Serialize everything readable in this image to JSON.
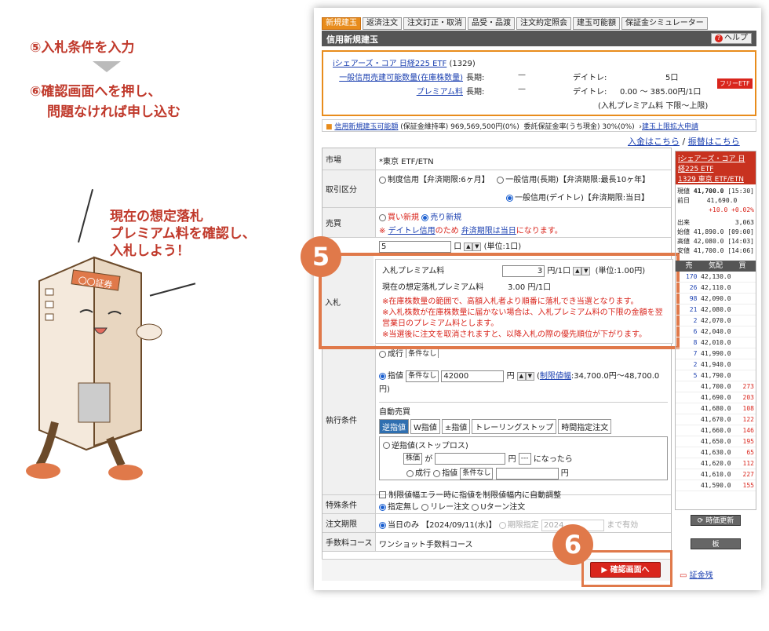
{
  "guide": {
    "step5": "⑤入札条件を入力",
    "step6_line1": "⑥確認画面へを押し、",
    "step6_line2": "問題なければ申し込む",
    "mascot_line1": "現在の想定落札",
    "mascot_line2": "プレミアム料を確認し、",
    "mascot_line3": "入札しよう！",
    "mascot_sign": "〇〇証券",
    "badge5": "5",
    "badge6": "6"
  },
  "tabs": [
    "新規建玉",
    "返済注文",
    "注文訂正・取消",
    "品受・品渡",
    "注文約定照会",
    "建玉可能額",
    "保証金シミュレーター"
  ],
  "header": {
    "title": "信用新規建玉",
    "help": "ヘルプ",
    "help_icon": "?"
  },
  "info": {
    "name": "iシェアーズ・コア 日経225 ETF",
    "code": "(1329)",
    "link_qty": "一般信用売建可能数量(在庫株数量)",
    "period_label1": "長期:",
    "period_val1": "—",
    "daytrade_label1": "デイトレ:",
    "daytrade_val1": "5口",
    "link_premium": "プレミアム料",
    "period_label2": "長期:",
    "period_val2": "—",
    "daytrade_label2": "デイトレ:",
    "daytrade_val2": "0.00 ～ 385.00円/1口",
    "daytrade_note": "(入札プレミアム料 下限～上限)",
    "free_badge": "フリーETF"
  },
  "credit_row": {
    "link1": "信用新規建玉可能額",
    "text1": "(保証金維持率) 969,569,500円(0%)",
    "text2": "委託保証金率(うち現金) 30%(0%)",
    "link2": "建玉上限拡大申請"
  },
  "links": {
    "deposit": "入金はこちら",
    "sep": "/",
    "transfer": "振替はこちら"
  },
  "form": {
    "market_label": "市場",
    "market_value": "*東京 ETF/ETN",
    "kubun_label": "取引区分",
    "kubun_opt1": "制度信用【弁済期限:6ヶ月】",
    "kubun_opt2": "一般信用(長期)【弁済期限:最長10ヶ年】",
    "kubun_opt3": "一般信用(デイトレ)【弁済期限:当日】",
    "baibai_label": "売買",
    "baibai_opt1": "買い新規",
    "baibai_opt2": "売り新規",
    "baibai_note_pre": "※",
    "baibai_note_link1": "デイトレ信用",
    "baibai_note_mid": "のため",
    "baibai_note_link2": "弁済期限は当日",
    "baibai_note_post": "になります。",
    "qty_value": "5",
    "qty_unit": "口",
    "qty_note": "(単位:1口)",
    "nyusatsu_label": "入札",
    "premium_label": "入札プレミアム料",
    "premium_value": "3",
    "premium_unit": "円/1口",
    "premium_note": "(単位:1.00円)",
    "est_label": "現在の想定落札プレミアム料",
    "est_value": "3.00 円/1口",
    "warn1": "※在庫株数量の範囲で、高額入札者より順番に落札でき当選となります。",
    "warn2": "※入札株数が在庫株数量に届かない場合は、入札プレミアム料の下限の金額を翌営業日のプレミアム料とします。",
    "warn3": "※当選後に注文を取消されますと、以降入札の際の優先順位が下がります。",
    "exec_label": "執行条件",
    "nari": "成行",
    "nari_sel": "条件なし",
    "sashine": "指値",
    "sashine_sel": "条件なし",
    "sashine_value": "42000",
    "yen": "円",
    "limit_link": "制限値幅",
    "limit_range": ":34,700.0円～48,700.0円)",
    "auto_label": "自動売買",
    "subtabs": [
      "逆指値",
      "W指値",
      "±指値",
      "トレーリングストップ",
      "時間指定注文"
    ],
    "stop_label": "逆指値(ストップロス)",
    "stop_sel": "株価",
    "stop_ga": "が",
    "stop_yen": "円",
    "stop_cond": "---",
    "stop_then": "になったら",
    "stop_nari": "成行",
    "stop_sashine": "指値",
    "stop_sel2": "条件なし",
    "stop_yen2": "円",
    "auto_adjust": "制限値幅エラー時に指値を制限値幅内に自動調整",
    "special_label": "特殊条件",
    "special_opt1": "指定無し",
    "special_opt2": "リレー注文",
    "special_opt3": "Uターン注文",
    "expiry_label": "注文期限",
    "expiry_opt1": "当日のみ 【2024/09/11(水)】",
    "expiry_opt2": "期限指定",
    "expiry_date": "2024",
    "expiry_post": "まで有効",
    "fee_label": "手数料コース",
    "fee_value": "ワンショット手数料コース",
    "confirm": "確認画面へ",
    "confirm_icon": "▶"
  },
  "quote": {
    "name_line1": "iシェアーズ・コア 日",
    "name_line2": "経225 ETF",
    "name_line3": "1329 東京 ETF/ETN",
    "current_label": "現値",
    "current_value": "41,700.0",
    "current_time": "[15:30]",
    "prev_label": "前日",
    "prev_value": "41,690.0",
    "change": "+10.0 +0.02%",
    "volume_label": "出来",
    "volume_value": "3,063",
    "open_label": "始値",
    "open_value": "41,890.0",
    "open_time": "[09:00]",
    "high_label": "高値",
    "high_value": "42,080.0",
    "high_time": "[14:03]",
    "low_label": "安値",
    "low_value": "41,700.0",
    "low_time": "[14:06]",
    "board_head": [
      "売",
      "気配",
      "買"
    ],
    "board": [
      [
        "170",
        "42,130.0",
        ""
      ],
      [
        "26",
        "42,110.0",
        ""
      ],
      [
        "98",
        "42,090.0",
        ""
      ],
      [
        "21",
        "42,080.0",
        ""
      ],
      [
        "2",
        "42,070.0",
        ""
      ],
      [
        "6",
        "42,040.0",
        ""
      ],
      [
        "8",
        "42,010.0",
        ""
      ],
      [
        "7",
        "41,990.0",
        ""
      ],
      [
        "2",
        "41,940.0",
        ""
      ],
      [
        "5",
        "41,790.0",
        ""
      ],
      [
        "",
        "41,700.0",
        "273"
      ],
      [
        "",
        "41,690.0",
        "203"
      ],
      [
        "",
        "41,680.0",
        "108"
      ],
      [
        "",
        "41,670.0",
        "122"
      ],
      [
        "",
        "41,660.0",
        "146"
      ],
      [
        "",
        "41,650.0",
        "195"
      ],
      [
        "",
        "41,630.0",
        "65"
      ],
      [
        "",
        "41,620.0",
        "112"
      ],
      [
        "",
        "41,610.0",
        "227"
      ],
      [
        "",
        "41,590.0",
        "155"
      ]
    ],
    "refresh": "時価更新",
    "ita": "板",
    "shoken": "証金残"
  }
}
